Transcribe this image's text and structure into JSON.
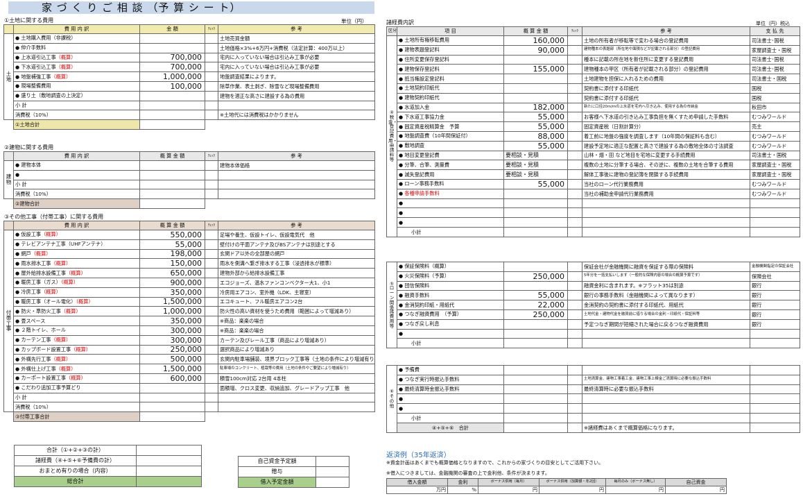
{
  "title": "家 づ く り ご 相 談 （予 算 シ ー ト）",
  "left": {
    "sec1": {
      "heading": "①土地に関する費用",
      "unit": "単位（円）",
      "cols": [
        "費 用 内 訳",
        "金 額",
        "ﾁｪｯｸ",
        "参 考"
      ],
      "side": "土地",
      "rows": [
        {
          "item": "土地購入費用（非課税）",
          "red": "",
          "amount": "",
          "note": "土地売買金額"
        },
        {
          "item": "仲介手数料",
          "red": "",
          "amount": "",
          "note": "土地価格×3%+6万円+消費税（法定計算：400万以上）"
        },
        {
          "item": "上水道引込工事",
          "red": "（概算）",
          "amount": "700,000",
          "note": "宅内に入っていない場合は引込み工事が必要"
        },
        {
          "item": "下水道引込工事",
          "red": "（概算）",
          "amount": "700,000",
          "note": "宅内に入っていない場合は引込み工事が必要"
        },
        {
          "item": "地盤補強工事",
          "red": "（概算）",
          "amount": "1,000,000",
          "note": "地盤調査結果によります。"
        },
        {
          "item": "現場整備費用",
          "red": "",
          "amount": "100,000",
          "note": "除草作業、表土剥ぎ、除雪など現場整備費用"
        },
        {
          "item": "盛り土（敷地調査の上決定）",
          "red": "",
          "amount": "",
          "note": "建物を適正な高さに建設する為の費用"
        }
      ],
      "subtotal": "小 計",
      "tax": "消費税（10%）",
      "tax_note": "※土地代には消費税はかかりません",
      "total": "①土地合計"
    },
    "sec2": {
      "heading": "②建物に関する費用",
      "cols": [
        "費 用 内 訳",
        "概 算 金 額",
        "ﾁｪｯｸ",
        "参 考"
      ],
      "side": "建物",
      "rows": [
        {
          "item": "建物本体",
          "note": "建物本体価格"
        },
        {
          "item": "",
          "note": ""
        }
      ],
      "subtotal": "小 計",
      "tax": "消費税（10%）",
      "total": "②建物合計"
    },
    "sec3": {
      "heading": "③その他工事（付帯工事）に関する費用",
      "cols": [
        "費 用 内 訳",
        "概 算 金 額",
        "ﾁｪｯｸ",
        "参 考"
      ],
      "side": "付帯工事",
      "rows": [
        {
          "item": "仮設工事",
          "red": "（概算）",
          "amount": "550,000",
          "note": "足場や養生、仮設トイレ、仮設電気代　他"
        },
        {
          "item": "テレビアンテナ工事（UHFアンテナ）",
          "red": "",
          "amount": "55,000",
          "note": "壁付けの平面アンテナ及びBSアンテナは別途とする"
        },
        {
          "item": "網戸",
          "red": "（概算）",
          "amount": "198,000",
          "note": "玄関ドア以外の全部屋の網戸"
        },
        {
          "item": "雨水排水工事",
          "red": "（概算）",
          "amount": "150,000",
          "note": "雨水を側溝へ繋ぎ排水する工事（浸透排水が標準）"
        },
        {
          "item": "屋外給排水設備工事",
          "red": "（概算）",
          "amount": "650,000",
          "note": "建物外部から給排水設備工事"
        },
        {
          "item": "暖房工事（ガス）",
          "red": "（概算）",
          "amount": "900,000",
          "note": "エコジョーズ、温水ファンコンベクター大1、小1"
        },
        {
          "item": "冷房工事",
          "red": "（概算）",
          "amount": "350,000",
          "note": "冷房用エアコン、室外機（LDK、主寝室）"
        },
        {
          "item": "暖房工事（オール電化）",
          "red": "（概算）",
          "amount": "1,500,000",
          "note": "エコキュート、フル暖房エアコン2台"
        },
        {
          "item": "防火・準防火工事",
          "red": "（概算）",
          "amount": "1,000,000",
          "note": "防火性の高い資材を使うため費用（範囲によって増減あり）"
        },
        {
          "item": "畳スペース",
          "red": "",
          "amount": "350,000",
          "note": "※商品：楽楽の場合"
        },
        {
          "item": "２階トイレ、ホール",
          "red": "",
          "amount": "300,000",
          "note": "※商品：楽楽の場合"
        },
        {
          "item": "カーテン工事",
          "red": "（概算）",
          "amount": "300,000",
          "note": "カーテン及びレール工事（商品により増減あり）"
        },
        {
          "item": "カップボード設置工事",
          "red": "（概算）",
          "amount": "250,000",
          "note": "選択商品により増減あり"
        },
        {
          "item": "外構先行工事",
          "red": "（概算）",
          "amount": "500,000",
          "note": "玄関内駐車場舗装、境界ブロック工事等（土地の条件により増減有り）"
        },
        {
          "item": "外構仕上げ工事",
          "red": "（概算）",
          "amount": "1,500,000",
          "note": "駐車場のコンクリート、植栽等の費用（土地の条件やご要望により増減有り）"
        },
        {
          "item": "カーポート設置工事",
          "red": "（概算）",
          "amount": "600,000",
          "note": "積雪100cm対応 2台用 4本柱"
        },
        {
          "item": "こだわり追加工事予算どり",
          "red": "",
          "amount": "",
          "note": "面積増、クロス変更、収納追加、グレードアップ工事　他"
        }
      ],
      "subtotal": "小 計",
      "tax": "消費税（10%）",
      "total": "③付帯工事合計"
    },
    "summary": [
      "合計（①+②+③の計）",
      "諸経費（④+⑤+⑥予備費の計）",
      "おまとめ有りの場合（内容）",
      "総合計"
    ],
    "funds": [
      "自己資金予定額",
      "贈与",
      "借入予定金額"
    ]
  },
  "right": {
    "heading": "諸経費内訳",
    "unit": "単位（円）税込",
    "cols": [
      "区分",
      "項 目",
      "概 算 金 額",
      "ﾁｪｯｸ",
      "参 考",
      "支 払 先"
    ],
    "sec4": {
      "side": "④税金・登記費用・申請料等",
      "rows": [
        {
          "item": "土地所有権移転費用",
          "amount": "160,000",
          "note": "土地の所有者が移転等で変わる場合の登記費用",
          "payee": "司法書士･国税"
        },
        {
          "item": "建物表題登記料",
          "amount": "90,000",
          "note": "建物種本の表題部（所在地や面積などが記載される部分）の登記費用",
          "payee": "家屋調査士・国税"
        },
        {
          "item": "住所変更保存登記料",
          "amount": "",
          "note": "種本に記載の所在地を新住所に変更する登記費用",
          "payee": "司法書士･国税"
        },
        {
          "item": "建物保存登記料",
          "amount": "155,000",
          "note": "建物種本の甲区（所有者が記載される部分）の登記費用",
          "payee": "司法書士･国税"
        },
        {
          "item": "抵当権設定登記料",
          "amount": "",
          "note": "土地建物を担保に入れるための費用",
          "payee": "司法書士・国税"
        },
        {
          "item": "土地契約印紙代",
          "amount": "",
          "note": "契約書に添付する印紙代",
          "payee": "国税"
        },
        {
          "item": "建物契約印紙代",
          "amount": "",
          "note": "契約書に添付する印紙代",
          "payee": "国税"
        },
        {
          "item": "水道加入金",
          "amount": "182,000",
          "note": "新たに口径20m/mの上水道を宅内へ引き込み、使用する為の市納金",
          "payee": "秋田市"
        },
        {
          "item": "下水道工事協力金",
          "amount": "55,000",
          "note": "お客様へ下水道の引き込み工事負担を無くすため申請した手数料",
          "payee": "むつみワールド"
        },
        {
          "item": "固定資産税精算金　予算",
          "amount": "55,000",
          "note": "固定資産税（日割計算分）",
          "payee": "売主"
        },
        {
          "item": "地盤調査費（10年間保証付）",
          "amount": "88,000",
          "note": "着工前に地盤の強度を調査します（10年間の保証料も含む）",
          "payee": "むつみワールド"
        },
        {
          "item": "敷地調査",
          "amount": "55,000",
          "note": "建設予定地に適正な配置と高さで建設する為の敷地全体の寸法調査",
          "payee": "むつみワールド"
        },
        {
          "item": "地目変更登記費",
          "amount": "要相談・見積",
          "note": "山林・畑・田 など地目を宅地に変更する手続費用",
          "payee": "司法書士・国税"
        },
        {
          "item": "分筆、合筆、測量費",
          "amount": "要相談・見積",
          "note": "複数の土地に分筆する場合、その逆に、複数の土地を合筆する費用",
          "payee": "家屋調査士・国税"
        },
        {
          "item": "滅失登記費用",
          "amount": "要相談・見積",
          "note": "解体工事後に建物の登記簿を閉鎖する手続費用",
          "payee": "家屋調査士・国税"
        },
        {
          "item": "ローン事務手数料",
          "amount": "55,000",
          "note": "当社のローン代行業務費用",
          "payee": "むつみワールド"
        },
        {
          "item": "各種申請手数料",
          "amount": "",
          "note": "当社の補助金申請代行業務費用",
          "payee": "むつみワールド",
          "red": true
        },
        {
          "item": "",
          "amount": "",
          "note": "",
          "payee": ""
        },
        {
          "item": "",
          "amount": "",
          "note": "",
          "payee": ""
        },
        {
          "item": "",
          "amount": "",
          "note": "",
          "payee": ""
        }
      ],
      "subtotal": "小計"
    },
    "sec5": {
      "side": "⑤ローン関係諸費用等",
      "rows": [
        {
          "item": "保証保険料（概算）",
          "amount": "",
          "note": "保証会社が金融機関に融資を保証する際の保険料",
          "payee": "金融機関指定の保証会社"
        },
        {
          "item": "火災保険料（予算）",
          "amount": "250,000",
          "note": "5年分を一括支払いします（一般的な保険内容の場合の概算予算です）",
          "payee": "保険会社"
        },
        {
          "item": "団信保険料",
          "amount": "",
          "note": "融資金利に含まれます。※フラット35は別途",
          "payee": "銀行"
        },
        {
          "item": "融資手数料",
          "amount": "55,000",
          "note": "銀行の事務手数料（金融機関によって異なります）",
          "payee": "銀行"
        },
        {
          "item": "金消契約印紙・用紙代",
          "amount": "22,000",
          "note": "金消契約の契約書に添付する印紙代、用紙代",
          "payee": "銀行"
        },
        {
          "item": "つなぎ融資費用　（予算）",
          "amount": "250,000",
          "note": "土地代金・建物代金を融資前に借りる場合の金利・印紙代・保証料等",
          "payee": "銀行"
        },
        {
          "item": "つなぎ戻し利息",
          "amount": "",
          "note": "予定つなぎ期間が短縮された場合に戻るつなぎ融資費用",
          "payee": "銀行"
        },
        {
          "item": "",
          "amount": "",
          "note": "",
          "payee": ""
        }
      ],
      "subtotal": "小計"
    },
    "sec6": {
      "side": "⑥その他",
      "rows": [
        {
          "item": "予備費",
          "note": ""
        },
        {
          "item": "つなぎ実行時振込手数料",
          "note": "土地清算金、建物工事着工金、建物工事上棟金ご清算時に必要な振込手数料"
        },
        {
          "item": "最終清算時金振込手数料",
          "note": "最終清算時に必要な振込手数料"
        },
        {
          "item": "",
          "note": ""
        },
        {
          "item": "",
          "note": ""
        }
      ],
      "subtotal": "小計",
      "total_label": "④+⑤+⑥　合計",
      "total_note": "※諸経費はあくまで概算価格になります。"
    },
    "repay": {
      "title": "返済例（35年返済）",
      "line1": "※資金計画はあくまでも概算価格となりますので、これからの家づくりの目安としてご活用下さい。",
      "line2": "※借入につきましては、金融機関の審査の上で金利他、条件が決まります。",
      "cols": [
        "借入金額",
        "金利",
        "ボーナス併用（毎月）",
        "ボーナス併用（加算額・年2回）",
        "毎月のみ（ボーナス無し）",
        "自己資金"
      ],
      "units": [
        "万円",
        "%",
        "円",
        "円",
        "円",
        "円"
      ]
    }
  }
}
